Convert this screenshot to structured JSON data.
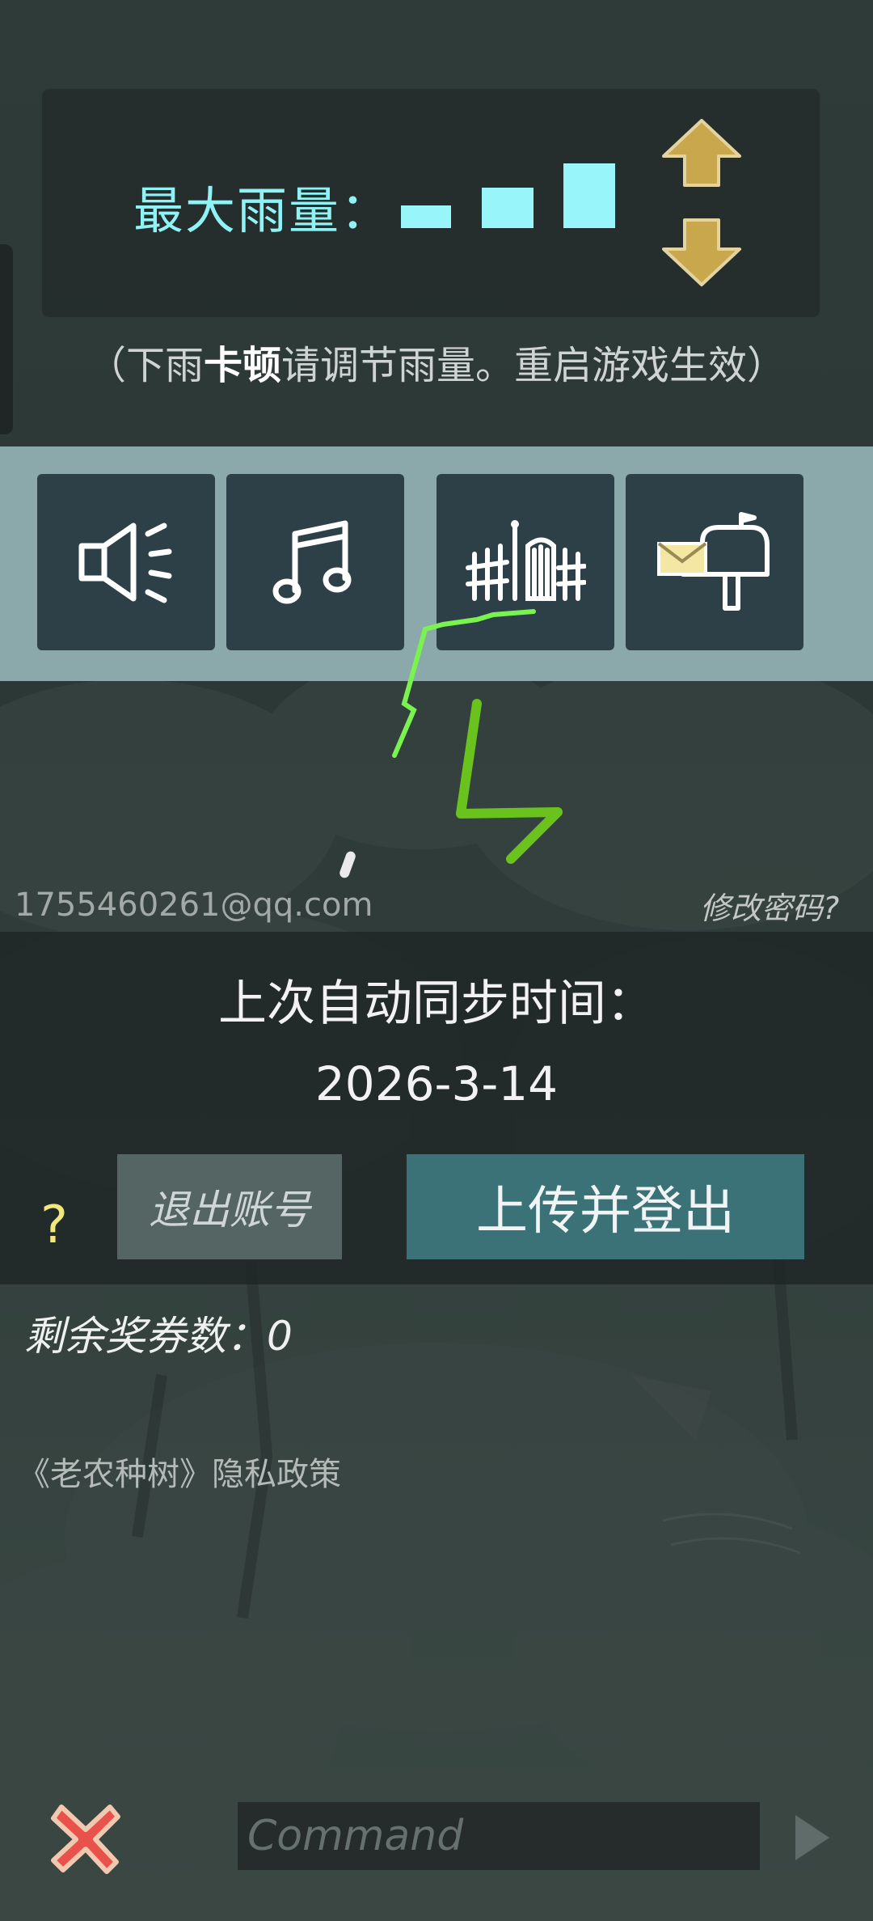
{
  "settings": {
    "rain_label": "最大雨量：",
    "rain_note_prefix": "（下雨",
    "rain_note_bold": "卡顿",
    "rain_note_suffix": "请调节雨量。重启游戏生效）",
    "rain_level": 3,
    "rain_level_max": 3
  },
  "icons": [
    "speaker-icon",
    "music-note-icon",
    "fence-gate-icon",
    "mailbox-icon"
  ],
  "account": {
    "email": "1755460261@qq.com",
    "change_password": "修改密码?",
    "sync_title": "上次自动同步时间：",
    "sync_date": "2026-3-14",
    "logout": "退出账号",
    "upload_logout": "上传并登出",
    "help": "?"
  },
  "tickets": "剩余奖券数：0",
  "privacy": "《老农种树》隐私政策",
  "command": {
    "placeholder": "Command",
    "value": ""
  },
  "colors": {
    "accent_cyan": "#98f6fa",
    "button_teal": "#3a7277",
    "arrow_gold": "#c9a74d",
    "close_red": "#e8524a"
  }
}
